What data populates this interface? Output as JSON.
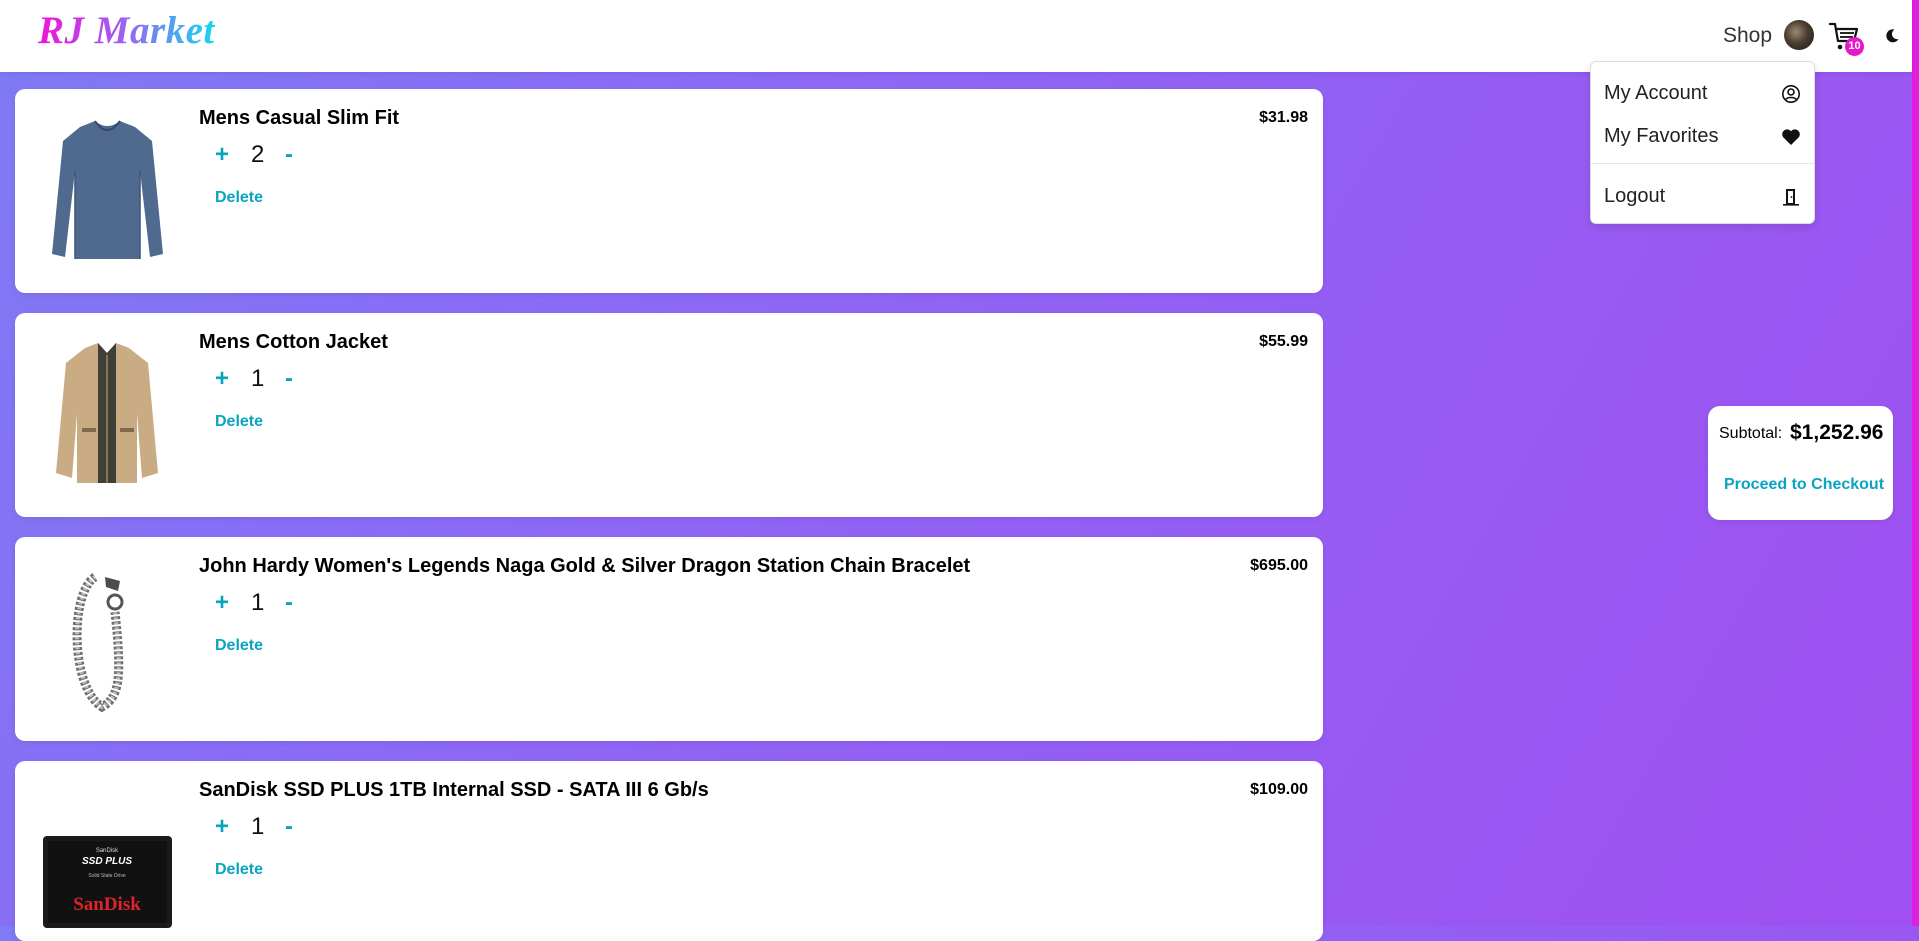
{
  "brand": {
    "logo_text": "RJ Market"
  },
  "nav": {
    "shop_label": "Shop",
    "cart_count": "10"
  },
  "user_menu": {
    "items": [
      {
        "label": "My Account",
        "icon": "user-circle-icon"
      },
      {
        "label": "My Favorites",
        "icon": "heart-icon"
      },
      {
        "label": "Logout",
        "icon": "door-exit-icon"
      }
    ]
  },
  "cart": {
    "items": [
      {
        "title": "Mens Casual Slim Fit",
        "price": "$31.98",
        "quantity": "2",
        "plus": "+",
        "minus": "-",
        "delete_label": "Delete"
      },
      {
        "title": "Mens Cotton Jacket",
        "price": "$55.99",
        "quantity": "1",
        "plus": "+",
        "minus": "-",
        "delete_label": "Delete"
      },
      {
        "title": "John Hardy Women's Legends Naga Gold & Silver Dragon Station Chain Bracelet",
        "price": "$695.00",
        "quantity": "1",
        "plus": "+",
        "minus": "-",
        "delete_label": "Delete"
      },
      {
        "title": "SanDisk SSD PLUS 1TB Internal SSD - SATA III 6 Gb/s",
        "price": "$109.00",
        "quantity": "1",
        "plus": "+",
        "minus": "-",
        "delete_label": "Delete"
      }
    ]
  },
  "summary": {
    "subtotal_label": "Subtotal:",
    "subtotal_value": "$1,252.96",
    "checkout_label": "Proceed to Checkout"
  },
  "ssd_label": {
    "brand": "SanDisk",
    "product": "SSD PLUS",
    "line1": "SanDisk",
    "line2": "Solid State Drive"
  },
  "colors": {
    "accent": "#0aa3c2",
    "badge": "#e619c6"
  }
}
